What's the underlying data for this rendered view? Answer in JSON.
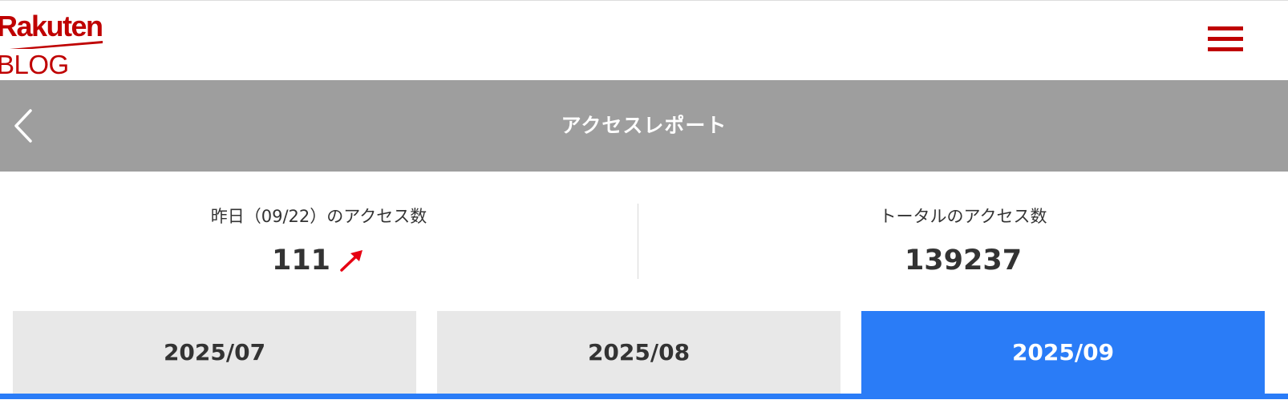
{
  "header": {
    "logo_brand": "Rakuten",
    "logo_sub": "BLOG",
    "logo_color": "#bf0000",
    "menu_icon": "hamburger-icon"
  },
  "titlebar": {
    "back_icon": "chevron-left-icon",
    "title": "アクセスレポート",
    "background": "#9e9e9e"
  },
  "stats": {
    "yesterday": {
      "label": "昨日（09/22）のアクセス数",
      "value": "111",
      "trend_icon": "arrow-up-right-icon",
      "trend_color": "#e60012"
    },
    "total": {
      "label": "トータルのアクセス数",
      "value": "139237"
    }
  },
  "tabs": [
    {
      "label": "2025/07",
      "active": false
    },
    {
      "label": "2025/08",
      "active": false
    },
    {
      "label": "2025/09",
      "active": true
    }
  ],
  "colors": {
    "active_tab": "#2a7cf7",
    "inactive_tab": "#e8e8e8"
  }
}
